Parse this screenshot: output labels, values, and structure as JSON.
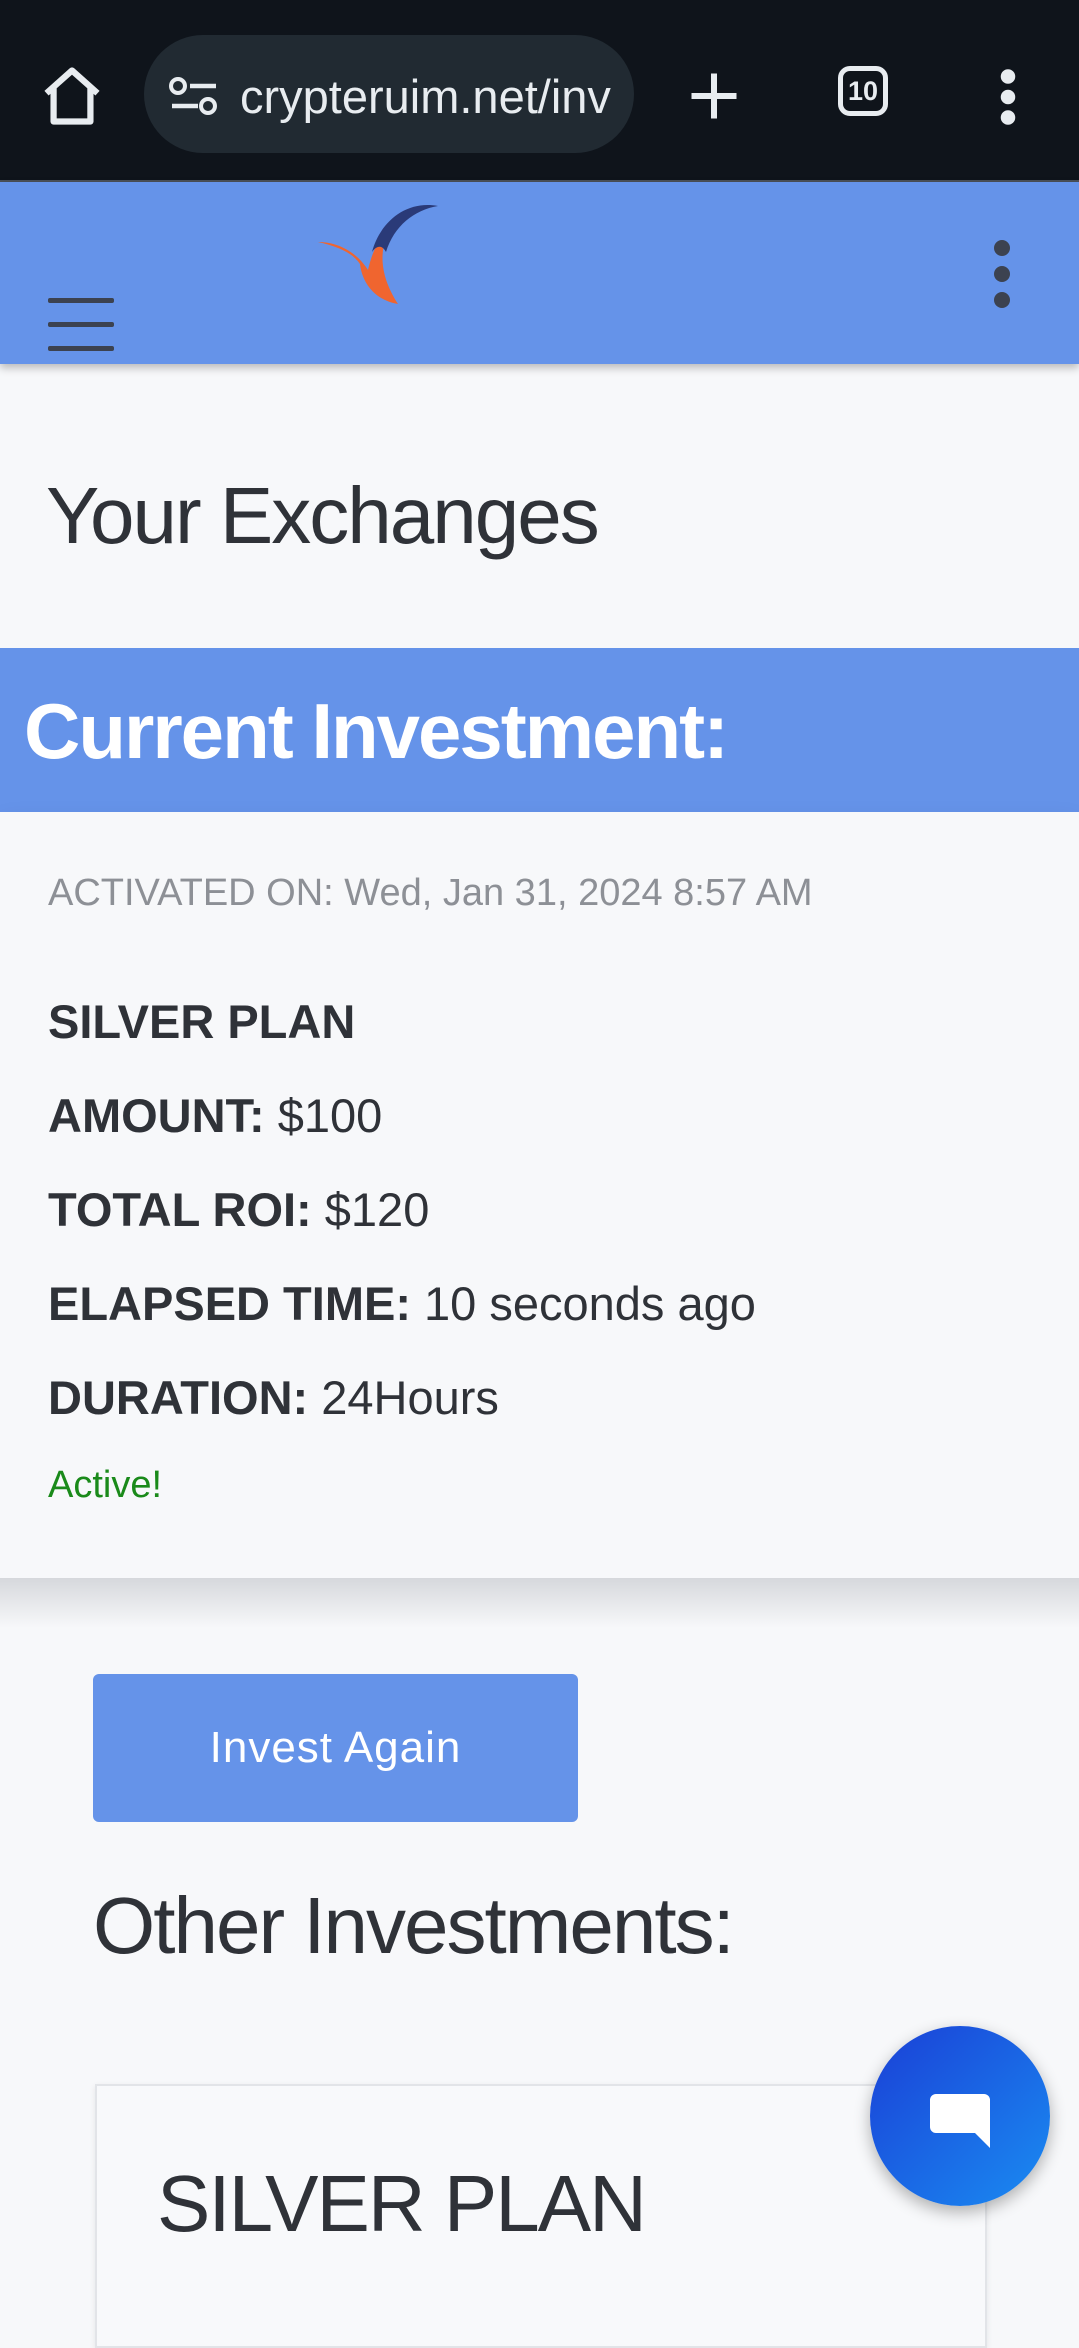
{
  "browser": {
    "url": "crypteruim.net/inv",
    "tab_count": "10"
  },
  "page": {
    "title": "Your Exchanges"
  },
  "current_investment": {
    "heading": "Current Investment:",
    "activated_label": "ACTIVATED ON:",
    "activated_value": "Wed, Jan 31, 2024 8:57 AM",
    "plan": "SILVER PLAN",
    "amount_label": "AMOUNT:",
    "amount_value": "$100",
    "roi_label": "TOTAL ROI:",
    "roi_value": "$120",
    "elapsed_label": "ELAPSED TIME:",
    "elapsed_value": "10 seconds ago",
    "duration_label": "DURATION:",
    "duration_value": "24Hours",
    "status": "Active!"
  },
  "actions": {
    "invest_again": "Invest Again"
  },
  "other_investments": {
    "heading": "Other Investments:",
    "items": [
      {
        "name": "SILVER PLAN"
      }
    ]
  },
  "colors": {
    "accent": "#6593e9",
    "status_active": "#1a8a1a",
    "chat_fab": "#1a5ae6"
  }
}
